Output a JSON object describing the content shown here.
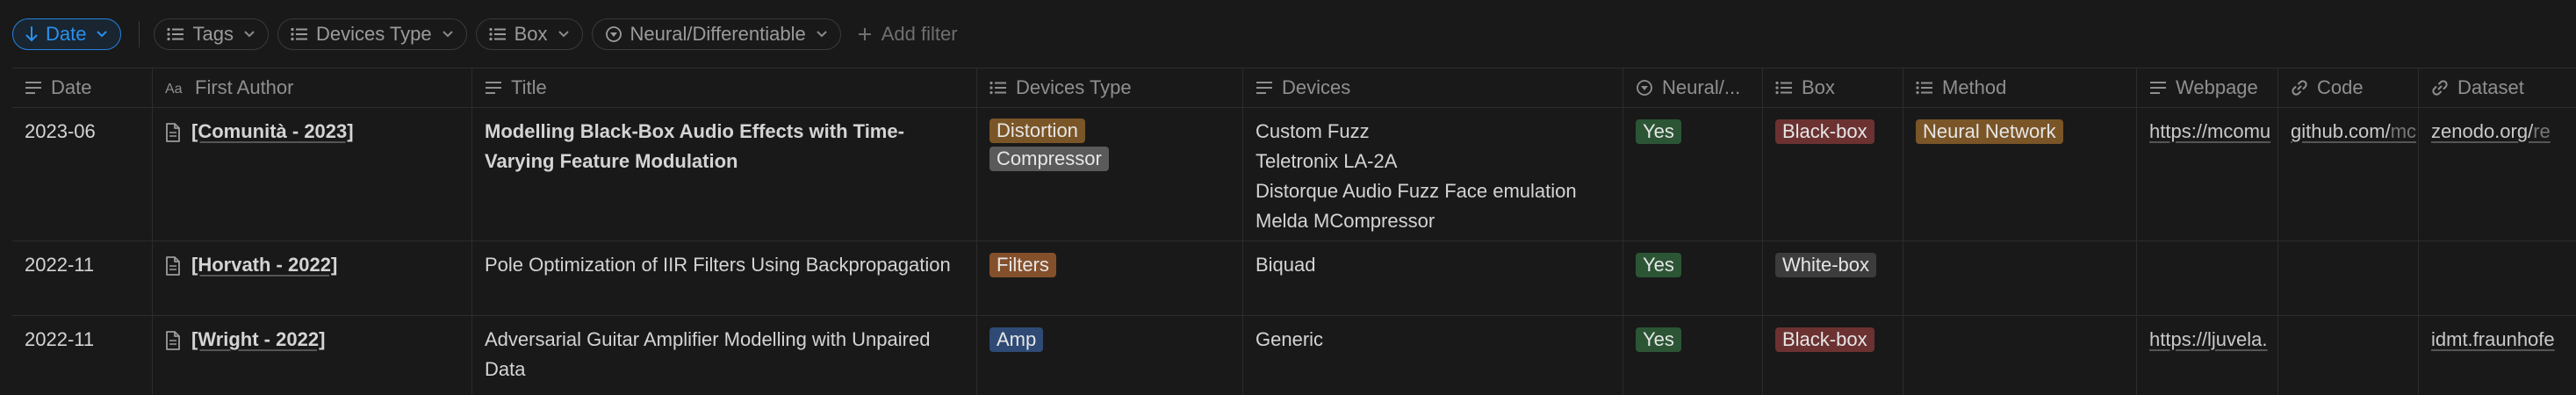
{
  "filters": {
    "sort": {
      "label": "Date",
      "icon": "arrow-down-icon"
    },
    "chips": [
      {
        "label": "Tags",
        "icon": "list-icon"
      },
      {
        "label": "Devices Type",
        "icon": "list-icon"
      },
      {
        "label": "Box",
        "icon": "list-icon"
      },
      {
        "label": "Neural/Differentiable",
        "icon": "circle-chevron-icon"
      }
    ],
    "add_filter": "Add filter"
  },
  "columns": [
    {
      "key": "date",
      "label": "Date",
      "icon": "text-lines-icon"
    },
    {
      "key": "author",
      "label": "First Author",
      "icon": "title-aa-icon"
    },
    {
      "key": "title",
      "label": "Title",
      "icon": "text-lines-icon"
    },
    {
      "key": "devices_type",
      "label": "Devices Type",
      "icon": "list-icon"
    },
    {
      "key": "devices",
      "label": "Devices",
      "icon": "text-lines-icon"
    },
    {
      "key": "neural",
      "label": "Neural/...",
      "icon": "circle-chevron-icon"
    },
    {
      "key": "box",
      "label": "Box",
      "icon": "list-icon"
    },
    {
      "key": "method",
      "label": "Method",
      "icon": "list-icon"
    },
    {
      "key": "webpage",
      "label": "Webpage",
      "icon": "text-lines-icon"
    },
    {
      "key": "code",
      "label": "Code",
      "icon": "link-icon"
    },
    {
      "key": "dataset",
      "label": "Dataset",
      "icon": "link-icon"
    }
  ],
  "colors": {
    "distortion": "#7a5527",
    "compressor": "#5a5a5a",
    "filters": "#84502c",
    "amp": "#2e4a75",
    "yes": "#2c5535",
    "black_box": "#6c3232",
    "white_box": "#3c3c3c",
    "neural_network": "#7a5527"
  },
  "rows": [
    {
      "date": "2023-06",
      "author": "[Comunità - 2023]",
      "title": "Modelling Black-Box Audio Effects with Time-Varying Feature Modulation",
      "devices_type": [
        "Distortion",
        "Compressor"
      ],
      "devices": [
        "Custom Fuzz",
        "Teletronix LA-2A",
        "Distorque Audio Fuzz Face emulation",
        "Melda MCompressor"
      ],
      "neural": "Yes",
      "box": "Black-box",
      "method": "Neural Network",
      "webpage": "https://mcomu",
      "code_main": "github.com/",
      "code_muted": "mc",
      "dataset_main": "zenodo.org/",
      "dataset_muted": "re"
    },
    {
      "date": "2022-11",
      "author": "[Horvath - 2022]",
      "title": "Pole Optimization of IIR Filters Using Backpropagation",
      "devices_type": [
        "Filters"
      ],
      "devices": [
        "Biquad"
      ],
      "neural": "Yes",
      "box": "White-box",
      "method": "",
      "webpage": "",
      "code_main": "",
      "code_muted": "",
      "dataset_main": "",
      "dataset_muted": ""
    },
    {
      "date": "2022-11",
      "author": "[Wright - 2022]",
      "title": "Adversarial Guitar Amplifier Modelling with Unpaired Data",
      "devices_type": [
        "Amp"
      ],
      "devices": [
        "Generic"
      ],
      "neural": "Yes",
      "box": "Black-box",
      "method": "",
      "webpage": "https://ljuvela.",
      "code_main": "",
      "code_muted": "",
      "dataset_main": "idmt.fraunhofe",
      "dataset_muted": ""
    }
  ]
}
